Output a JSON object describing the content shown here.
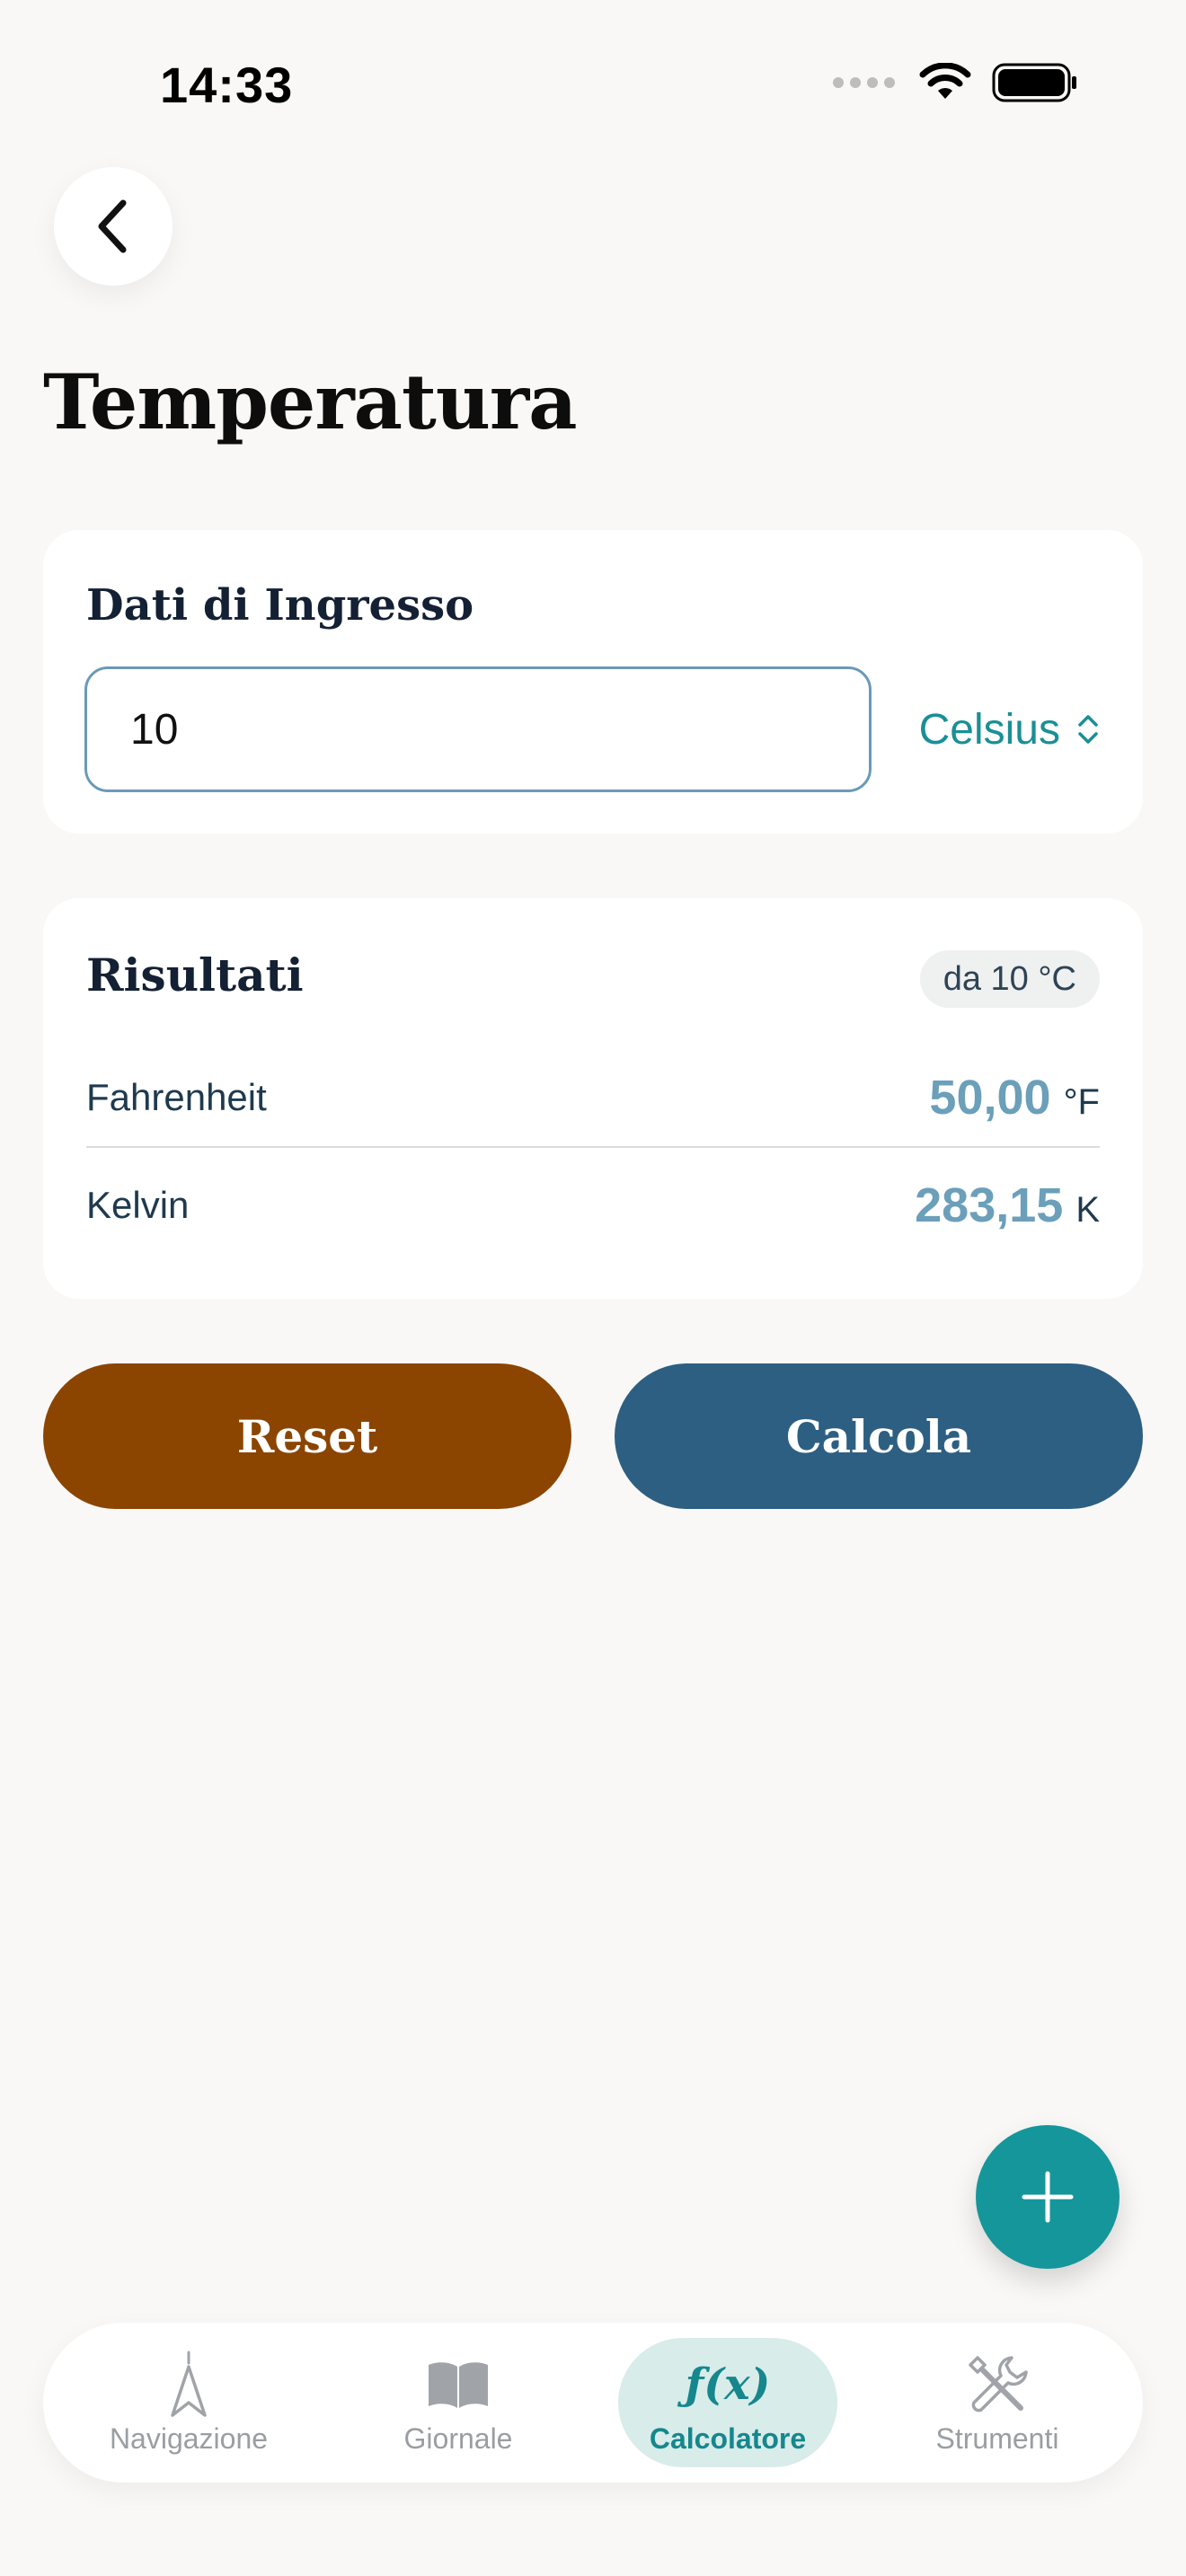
{
  "status": {
    "time": "14:33"
  },
  "page": {
    "title": "Temperatura"
  },
  "input_card": {
    "title": "Dati di Ingresso",
    "value": "10",
    "unit": "Celsius"
  },
  "results_card": {
    "title": "Risultati",
    "badge": "da 10 °C",
    "rows": [
      {
        "label": "Fahrenheit",
        "value": "50,00",
        "unit": "°F"
      },
      {
        "label": "Kelvin",
        "value": "283,15",
        "unit": "K"
      }
    ]
  },
  "buttons": {
    "reset": "Reset",
    "calculate": "Calcola"
  },
  "tabs": [
    {
      "label": "Navigazione",
      "icon": "compass-arrow-icon"
    },
    {
      "label": "Giornale",
      "icon": "book-icon"
    },
    {
      "label": "Calcolatore",
      "icon": "function-icon",
      "glyph": "ƒ(x)",
      "active": true
    },
    {
      "label": "Strumenti",
      "icon": "tools-icon"
    }
  ],
  "colors": {
    "accent": "#15969a",
    "reset": "#8b4501",
    "calculate": "#2d5f82",
    "result_value": "#6b9fba"
  }
}
